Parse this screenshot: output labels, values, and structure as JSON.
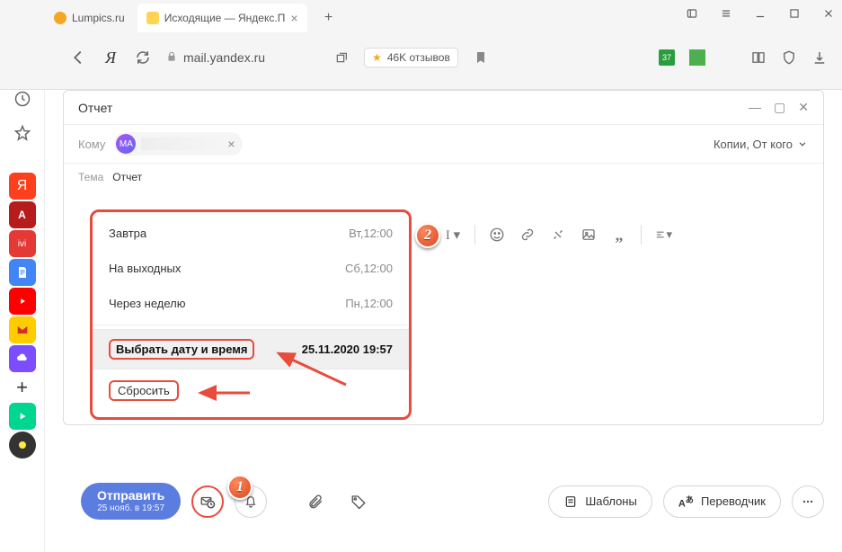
{
  "tabs": [
    {
      "label": "Lumpics.ru",
      "favicon": "#f5a623"
    },
    {
      "label": "Исходящие — Яндекс.П",
      "favicon": "#ffd452",
      "active": true
    }
  ],
  "url": "mail.yandex.ru",
  "reviewsPill": "46K отзывов",
  "calendarBadge": "37",
  "compose": {
    "title": "Отчет",
    "toLabel": "Кому",
    "chipInitials": "MA",
    "copies": "Копии, От кого",
    "subjectLabel": "Тема",
    "subjectValue": "Отчет"
  },
  "menu": {
    "items": [
      {
        "label": "Завтра",
        "when": "Вт,12:00"
      },
      {
        "label": "На выходных",
        "when": "Сб,12:00"
      },
      {
        "label": "Через неделю",
        "when": "Пн,12:00"
      }
    ],
    "pickLabel": "Выбрать дату и время",
    "datetime": "25.11.2020 19:57",
    "resetLabel": "Сбросить"
  },
  "sendButton": {
    "label": "Отправить",
    "sub": "25 нояб. в 19:57"
  },
  "templatesBtn": "Шаблоны",
  "translatorBtn": "Переводчик",
  "badges": {
    "one": "1",
    "two": "2"
  }
}
